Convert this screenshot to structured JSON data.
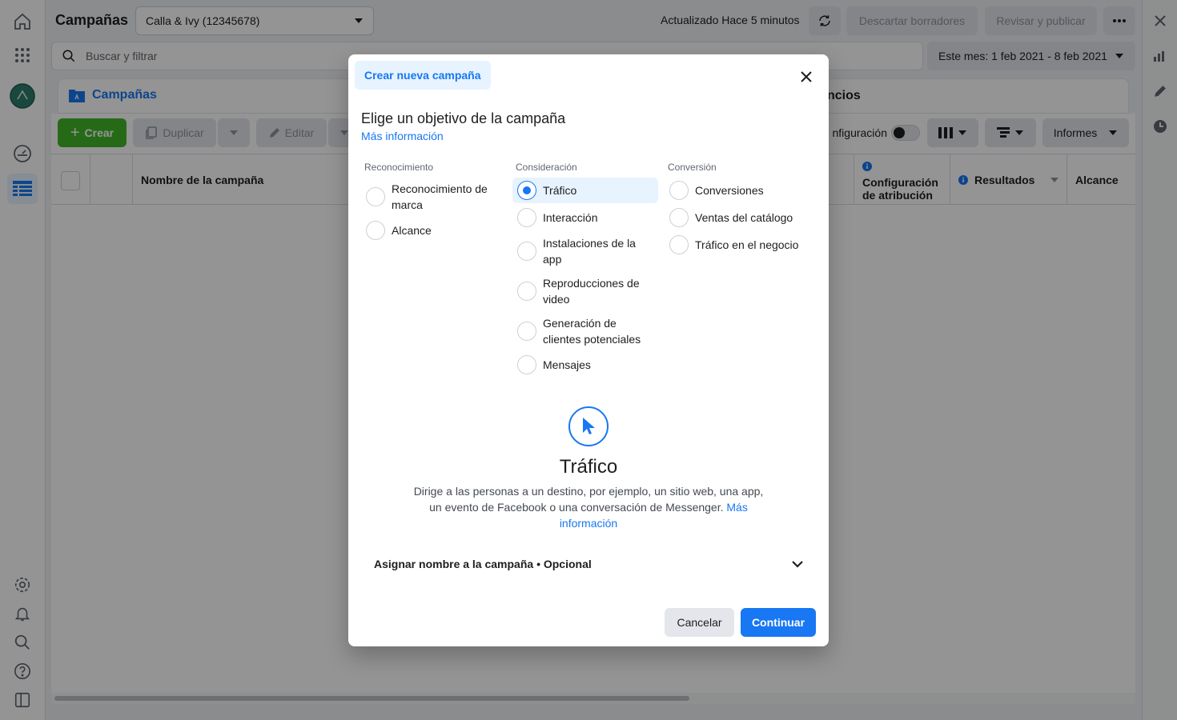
{
  "header": {
    "title": "Campañas",
    "account": "Calla & Ivy (12345678)",
    "updated": "Actualizado Hace 5 minutos",
    "discard_label": "Descartar borradores",
    "review_label": "Revisar y publicar"
  },
  "search": {
    "placeholder": "Buscar y filtrar"
  },
  "date_range": "Este mes: 1 feb 2021 - 8 feb 2021",
  "tabs": {
    "campaigns": "Campañas",
    "ads_partial": "ncios"
  },
  "toolbar": {
    "create": "Crear",
    "duplicate": "Duplicar",
    "edit": "Editar",
    "config_partial": "nfiguración",
    "reports": "Informes"
  },
  "table": {
    "columns": {
      "name": "Nombre de la campaña",
      "attribution": "Configuración de atribución",
      "results": "Resultados",
      "reach": "Alcance"
    }
  },
  "modal": {
    "tab": "Crear nueva campaña",
    "title": "Elige un objetivo de la campaña",
    "more_info": "Más información",
    "groups": [
      {
        "heading": "Reconocimiento",
        "options": [
          "Reconocimiento de marca",
          "Alcance"
        ]
      },
      {
        "heading": "Consideración",
        "options": [
          "Tráfico",
          "Interacción",
          "Instalaciones de la app",
          "Reproducciones de video",
          "Generación de clientes potenciales",
          "Mensajes"
        ]
      },
      {
        "heading": "Conversión",
        "options": [
          "Conversiones",
          "Ventas del catálogo",
          "Tráfico en el negocio"
        ]
      }
    ],
    "selected": "Tráfico",
    "objective": {
      "title": "Tráfico",
      "description": "Dirige a las personas a un destino, por ejemplo, un sitio web, una app, un evento de Facebook o una conversación de Messenger.",
      "link": "Más información"
    },
    "name_row": "Asignar nombre a la campaña • Opcional",
    "cancel": "Cancelar",
    "continue": "Continuar"
  },
  "colors": {
    "accent": "#1877f2",
    "create_green": "#42b72a"
  }
}
